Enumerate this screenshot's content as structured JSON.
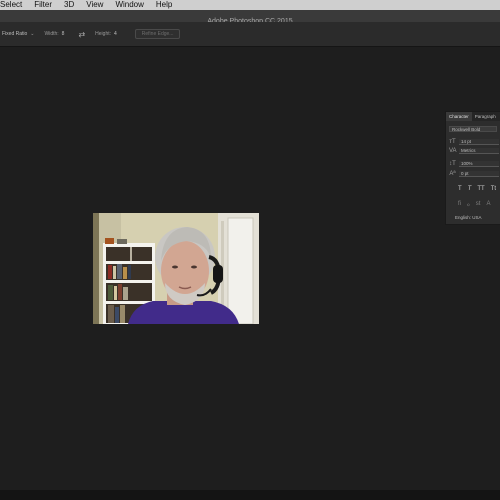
{
  "menu": [
    "Select",
    "Filter",
    "3D",
    "View",
    "Window",
    "Help"
  ],
  "app_title": "Adobe Photoshop CC 2015",
  "options_bar": {
    "ratio": "Fixed Ratio",
    "width_label": "Width:",
    "width_value": "8",
    "height_label": "Height:",
    "height_value": "4",
    "refine_edge": "Refine Edge..."
  },
  "character_panel": {
    "tabs": [
      "Character",
      "Paragraph"
    ],
    "font_style": "Rockwell Bold",
    "size": "14 pt",
    "kerning": "Metrics",
    "vertical_scale": "100%",
    "baseline_shift": "0 pt",
    "type_buttons": [
      "T",
      "T",
      "TT",
      "Tt"
    ],
    "opentype_buttons": [
      "ﬁ",
      "ℴ",
      "st",
      "A"
    ],
    "language": "English: USA"
  }
}
